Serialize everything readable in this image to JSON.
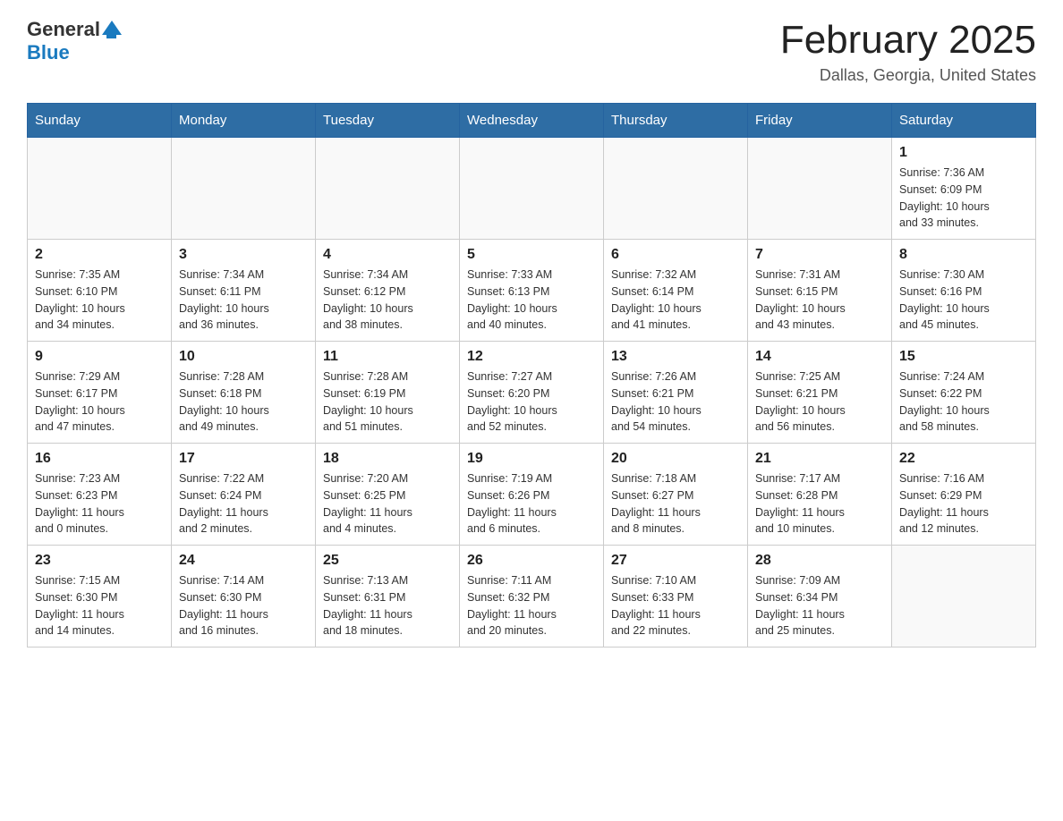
{
  "header": {
    "logo_general": "General",
    "logo_blue": "Blue",
    "month_title": "February 2025",
    "location": "Dallas, Georgia, United States"
  },
  "days_of_week": [
    "Sunday",
    "Monday",
    "Tuesday",
    "Wednesday",
    "Thursday",
    "Friday",
    "Saturday"
  ],
  "weeks": [
    [
      {
        "day": "",
        "info": ""
      },
      {
        "day": "",
        "info": ""
      },
      {
        "day": "",
        "info": ""
      },
      {
        "day": "",
        "info": ""
      },
      {
        "day": "",
        "info": ""
      },
      {
        "day": "",
        "info": ""
      },
      {
        "day": "1",
        "info": "Sunrise: 7:36 AM\nSunset: 6:09 PM\nDaylight: 10 hours\nand 33 minutes."
      }
    ],
    [
      {
        "day": "2",
        "info": "Sunrise: 7:35 AM\nSunset: 6:10 PM\nDaylight: 10 hours\nand 34 minutes."
      },
      {
        "day": "3",
        "info": "Sunrise: 7:34 AM\nSunset: 6:11 PM\nDaylight: 10 hours\nand 36 minutes."
      },
      {
        "day": "4",
        "info": "Sunrise: 7:34 AM\nSunset: 6:12 PM\nDaylight: 10 hours\nand 38 minutes."
      },
      {
        "day": "5",
        "info": "Sunrise: 7:33 AM\nSunset: 6:13 PM\nDaylight: 10 hours\nand 40 minutes."
      },
      {
        "day": "6",
        "info": "Sunrise: 7:32 AM\nSunset: 6:14 PM\nDaylight: 10 hours\nand 41 minutes."
      },
      {
        "day": "7",
        "info": "Sunrise: 7:31 AM\nSunset: 6:15 PM\nDaylight: 10 hours\nand 43 minutes."
      },
      {
        "day": "8",
        "info": "Sunrise: 7:30 AM\nSunset: 6:16 PM\nDaylight: 10 hours\nand 45 minutes."
      }
    ],
    [
      {
        "day": "9",
        "info": "Sunrise: 7:29 AM\nSunset: 6:17 PM\nDaylight: 10 hours\nand 47 minutes."
      },
      {
        "day": "10",
        "info": "Sunrise: 7:28 AM\nSunset: 6:18 PM\nDaylight: 10 hours\nand 49 minutes."
      },
      {
        "day": "11",
        "info": "Sunrise: 7:28 AM\nSunset: 6:19 PM\nDaylight: 10 hours\nand 51 minutes."
      },
      {
        "day": "12",
        "info": "Sunrise: 7:27 AM\nSunset: 6:20 PM\nDaylight: 10 hours\nand 52 minutes."
      },
      {
        "day": "13",
        "info": "Sunrise: 7:26 AM\nSunset: 6:21 PM\nDaylight: 10 hours\nand 54 minutes."
      },
      {
        "day": "14",
        "info": "Sunrise: 7:25 AM\nSunset: 6:21 PM\nDaylight: 10 hours\nand 56 minutes."
      },
      {
        "day": "15",
        "info": "Sunrise: 7:24 AM\nSunset: 6:22 PM\nDaylight: 10 hours\nand 58 minutes."
      }
    ],
    [
      {
        "day": "16",
        "info": "Sunrise: 7:23 AM\nSunset: 6:23 PM\nDaylight: 11 hours\nand 0 minutes."
      },
      {
        "day": "17",
        "info": "Sunrise: 7:22 AM\nSunset: 6:24 PM\nDaylight: 11 hours\nand 2 minutes."
      },
      {
        "day": "18",
        "info": "Sunrise: 7:20 AM\nSunset: 6:25 PM\nDaylight: 11 hours\nand 4 minutes."
      },
      {
        "day": "19",
        "info": "Sunrise: 7:19 AM\nSunset: 6:26 PM\nDaylight: 11 hours\nand 6 minutes."
      },
      {
        "day": "20",
        "info": "Sunrise: 7:18 AM\nSunset: 6:27 PM\nDaylight: 11 hours\nand 8 minutes."
      },
      {
        "day": "21",
        "info": "Sunrise: 7:17 AM\nSunset: 6:28 PM\nDaylight: 11 hours\nand 10 minutes."
      },
      {
        "day": "22",
        "info": "Sunrise: 7:16 AM\nSunset: 6:29 PM\nDaylight: 11 hours\nand 12 minutes."
      }
    ],
    [
      {
        "day": "23",
        "info": "Sunrise: 7:15 AM\nSunset: 6:30 PM\nDaylight: 11 hours\nand 14 minutes."
      },
      {
        "day": "24",
        "info": "Sunrise: 7:14 AM\nSunset: 6:30 PM\nDaylight: 11 hours\nand 16 minutes."
      },
      {
        "day": "25",
        "info": "Sunrise: 7:13 AM\nSunset: 6:31 PM\nDaylight: 11 hours\nand 18 minutes."
      },
      {
        "day": "26",
        "info": "Sunrise: 7:11 AM\nSunset: 6:32 PM\nDaylight: 11 hours\nand 20 minutes."
      },
      {
        "day": "27",
        "info": "Sunrise: 7:10 AM\nSunset: 6:33 PM\nDaylight: 11 hours\nand 22 minutes."
      },
      {
        "day": "28",
        "info": "Sunrise: 7:09 AM\nSunset: 6:34 PM\nDaylight: 11 hours\nand 25 minutes."
      },
      {
        "day": "",
        "info": ""
      }
    ]
  ]
}
